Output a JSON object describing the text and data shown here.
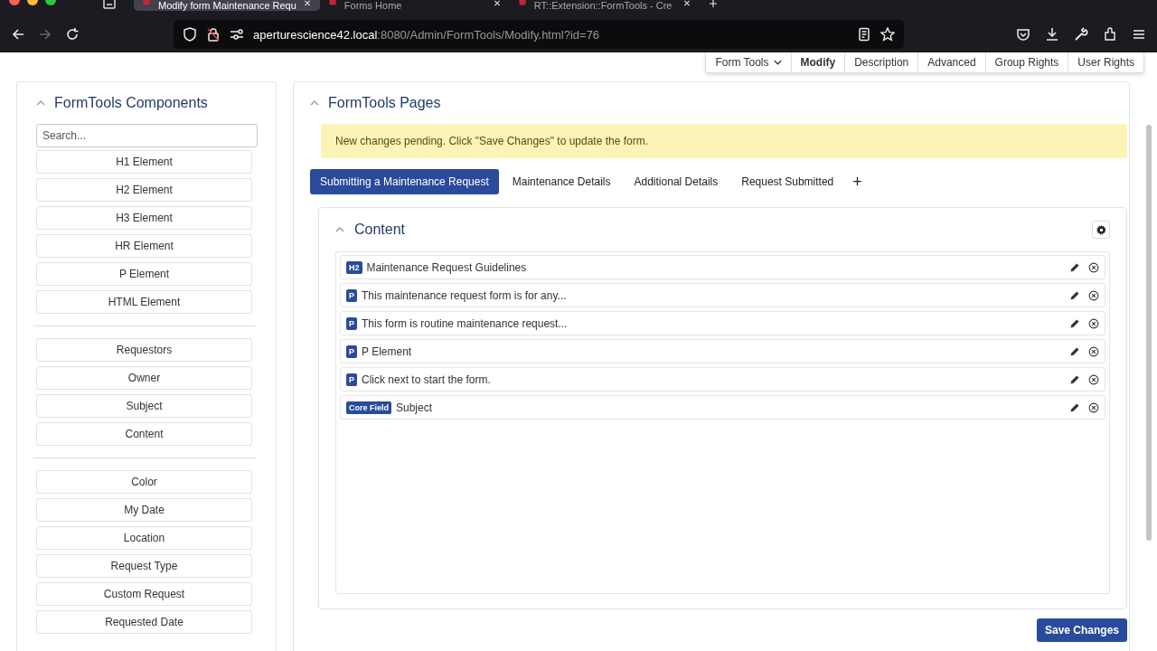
{
  "browser": {
    "tabs": [
      {
        "title": "Modify form Maintenance Requ",
        "selected": true
      },
      {
        "title": "Forms Home",
        "selected": false
      },
      {
        "title": "RT::Extension::FormTools - Cre",
        "selected": false
      }
    ],
    "address": {
      "host": "aperturescience42.local",
      "path": ":8080/Admin/FormTools/Modify.html?id=76"
    }
  },
  "page_menu": [
    {
      "label": "Form Tools",
      "dropdown": true,
      "selected": false
    },
    {
      "label": "Modify",
      "dropdown": false,
      "selected": true
    },
    {
      "label": "Description",
      "dropdown": false,
      "selected": false
    },
    {
      "label": "Advanced",
      "dropdown": false,
      "selected": false
    },
    {
      "label": "Group Rights",
      "dropdown": false,
      "selected": false
    },
    {
      "label": "User Rights",
      "dropdown": false,
      "selected": false
    }
  ],
  "components": {
    "title": "FormTools Components",
    "search": {
      "placeholder": "Search..."
    },
    "groups": [
      [
        "H1 Element",
        "H2 Element",
        "H3 Element",
        "HR Element",
        "P Element",
        "HTML Element"
      ],
      [
        "Requestors",
        "Owner",
        "Subject",
        "Content"
      ],
      [
        "Color",
        "My Date",
        "Location",
        "Request Type",
        "Custom Request",
        "Requested Date"
      ]
    ]
  },
  "pages": {
    "title": "FormTools Pages",
    "notice": "New changes pending. Click \"Save Changes\" to update the form.",
    "tabs": [
      {
        "label": "Submitting a Maintenance Request",
        "selected": true
      },
      {
        "label": "Maintenance Details",
        "selected": false
      },
      {
        "label": "Additional Details",
        "selected": false
      },
      {
        "label": "Request Submitted",
        "selected": false
      }
    ],
    "add_tab": "+",
    "content": {
      "title": "Content",
      "elements": [
        {
          "badge": "H2",
          "text": "Maintenance Request Guidelines"
        },
        {
          "badge": "P",
          "text": "This maintenance request form is for any..."
        },
        {
          "badge": "P",
          "text": "This form is routine maintenance request..."
        },
        {
          "badge": "P",
          "text": "P Element"
        },
        {
          "badge": "P",
          "text": "Click next to start the form."
        },
        {
          "badge": "Core Field",
          "text": "Subject"
        }
      ]
    },
    "save_button": "Save Changes"
  }
}
